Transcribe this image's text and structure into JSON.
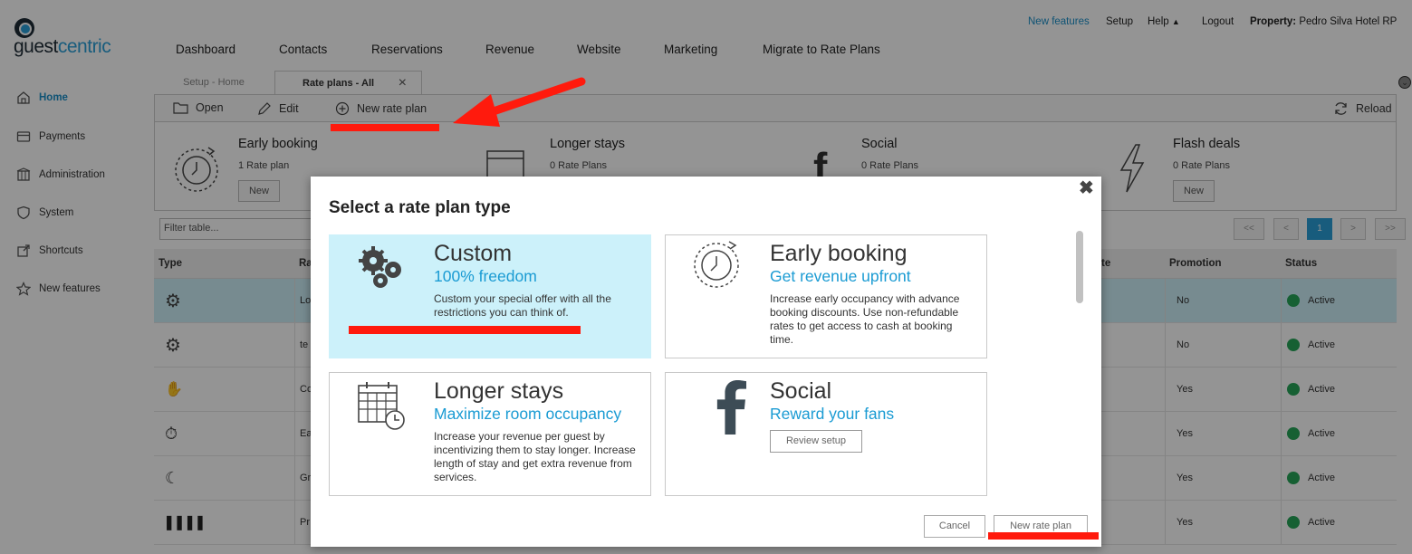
{
  "logo": {
    "g1": "guest",
    "g2": "centric"
  },
  "header": {
    "nav": [
      "Dashboard",
      "Contacts",
      "Reservations",
      "Revenue",
      "Website",
      "Marketing",
      "Migrate to Rate Plans"
    ],
    "new_features": "New features",
    "setup": "Setup",
    "help": "Help",
    "logout": "Logout",
    "property_label": "Property:",
    "property_name": "Pedro Silva Hotel RP"
  },
  "sidebar": {
    "items": [
      {
        "label": "Home",
        "icon": "home-icon",
        "active": true
      },
      {
        "label": "Payments",
        "icon": "card-icon"
      },
      {
        "label": "Administration",
        "icon": "building-icon"
      },
      {
        "label": "System",
        "icon": "shield-icon"
      },
      {
        "label": "Shortcuts",
        "icon": "external-link-icon"
      },
      {
        "label": "New features",
        "icon": "star-icon"
      }
    ]
  },
  "tabs": {
    "inactive": "Setup - Home",
    "active": "Rate plans - All"
  },
  "toolbar": {
    "open": "Open",
    "edit": "Edit",
    "new_rate_plan": "New rate plan",
    "reload": "Reload"
  },
  "cards": [
    {
      "title": "Early booking",
      "count": "1 Rate plan",
      "button": "New"
    },
    {
      "title": "Longer stays",
      "count": "0 Rate Plans"
    },
    {
      "title": "Social",
      "count": "0 Rate Plans"
    },
    {
      "title": "Flash deals",
      "count": "0 Rate Plans",
      "button": "New"
    }
  ],
  "table": {
    "filter_placeholder": "Filter table...",
    "pager": {
      "first": "<<",
      "prev": "<",
      "current": "1",
      "next": ">",
      "last": ">>"
    },
    "headers": {
      "type": "Type",
      "rate": "Ra",
      "date": "te",
      "promotion": "Promotion",
      "status": "Status"
    },
    "rows": [
      {
        "icon": "gears-icon",
        "name": "Lo",
        "promotion": "No",
        "status": "Active"
      },
      {
        "icon": "gears-icon",
        "name": "te",
        "promotion": "No",
        "status": "Active"
      },
      {
        "icon": "handshake-icon",
        "name": "Co",
        "promotion": "Yes",
        "status": "Active"
      },
      {
        "icon": "stopwatch-icon",
        "name": "Ea",
        "promotion": "Yes",
        "status": "Active"
      },
      {
        "icon": "moon-icon",
        "name": "Gr",
        "promotion": "Yes",
        "status": "Active"
      },
      {
        "icon": "barcode-icon",
        "name": "Pr",
        "promotion": "Yes",
        "status": "Active"
      }
    ]
  },
  "modal": {
    "title": "Select a rate plan type",
    "options": [
      {
        "title": "Custom",
        "subtitle": "100% freedom",
        "desc": "Custom your special offer with all the restrictions you can think of."
      },
      {
        "title": "Early booking",
        "subtitle": "Get revenue upfront",
        "desc": "Increase early occupancy with advance booking discounts. Use non-refundable rates to get access to cash at booking time."
      },
      {
        "title": "Longer stays",
        "subtitle": "Maximize room occupancy",
        "desc": "Increase your revenue per guest by incentivizing them to stay longer. Increase length of stay and get extra revenue from services."
      },
      {
        "title": "Social",
        "subtitle": "Reward your fans",
        "button": "Review setup"
      }
    ],
    "cancel": "Cancel",
    "confirm": "New rate plan"
  },
  "colors": {
    "accent": "#1a9bd3",
    "selected_bg": "#ccf1fa",
    "status_active": "#27a559",
    "annotation_red": "#ff1a0d"
  }
}
